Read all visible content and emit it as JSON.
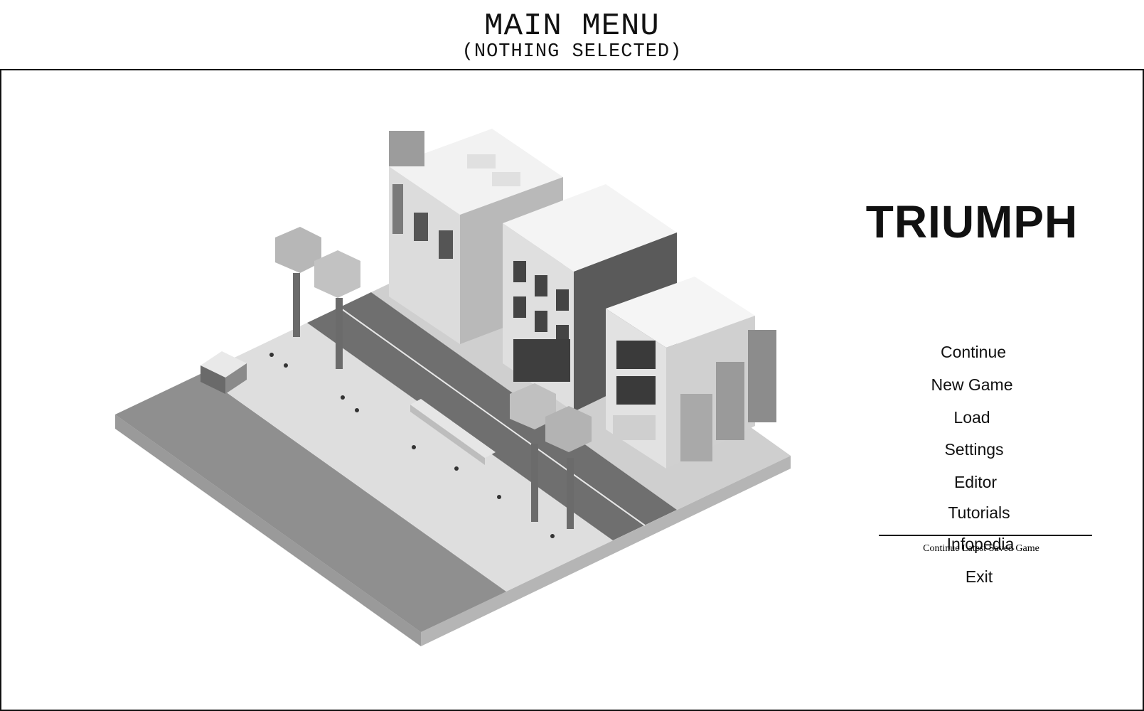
{
  "header": {
    "title": "MAIN MENU",
    "subtitle": "(NOTHING SELECTED)"
  },
  "game": {
    "logo": "TRIUMPH"
  },
  "menu": {
    "items": [
      {
        "label": "Continue"
      },
      {
        "label": "New Game"
      },
      {
        "label": "Load"
      },
      {
        "label": "Settings"
      },
      {
        "label": "Editor"
      },
      {
        "label": "Tutorials"
      },
      {
        "label": "Infopedia"
      },
      {
        "label": "Exit"
      }
    ],
    "hint": "Continue Latest Saved Game"
  },
  "scene": {
    "icon": "isometric-city-block-image"
  }
}
